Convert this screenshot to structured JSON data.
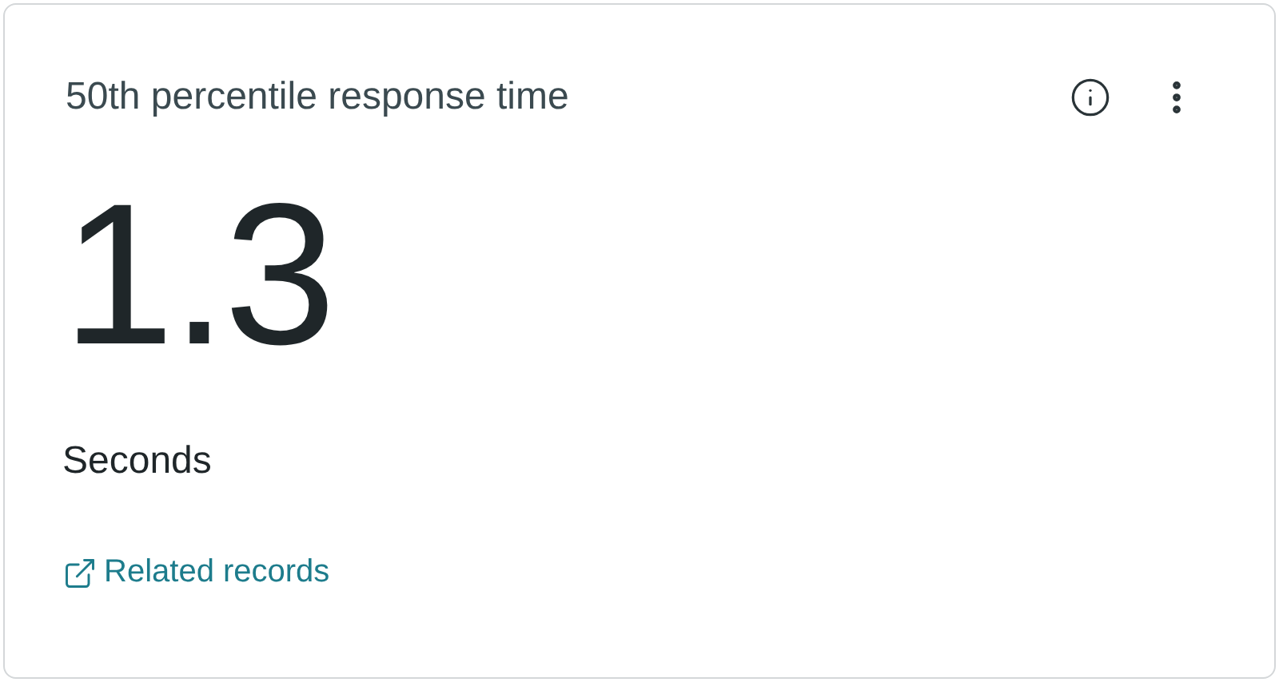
{
  "card": {
    "title": "50th percentile response time",
    "value": "1.3",
    "unit": "Seconds",
    "link": "Related records"
  }
}
